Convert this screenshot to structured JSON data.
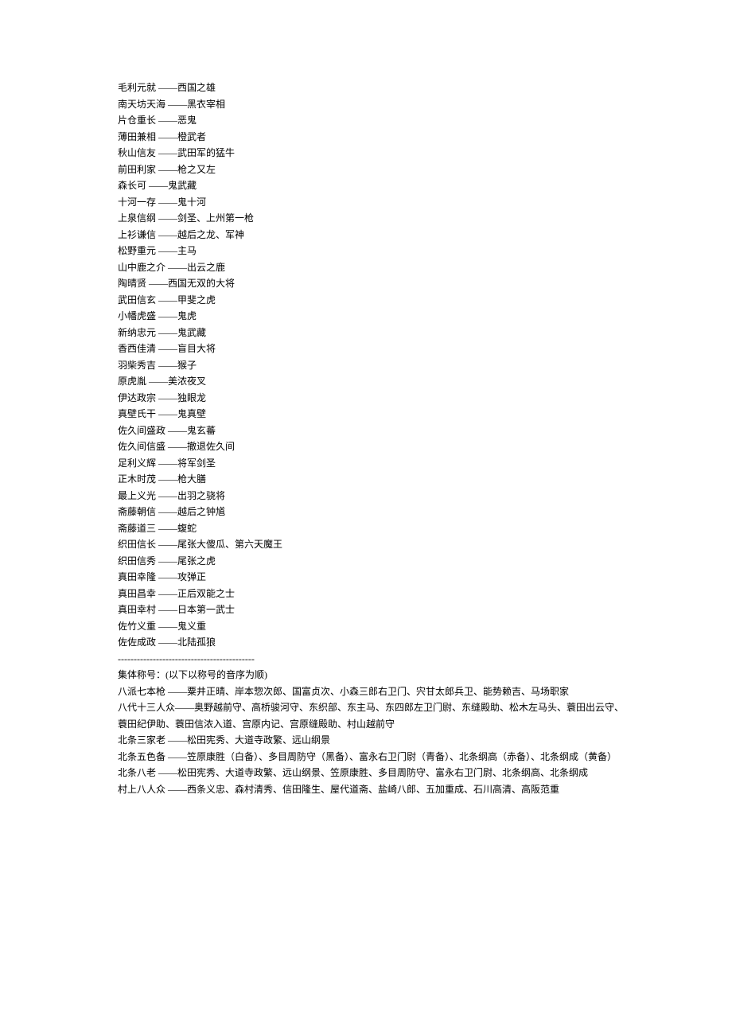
{
  "aliases": [
    {
      "name": "毛利元就",
      "title": "西国之雄"
    },
    {
      "name": "南天坊天海",
      "title": "黑衣宰相"
    },
    {
      "name": "片仓重长",
      "title": "恶鬼"
    },
    {
      "name": "薄田兼相",
      "title": "橙武者"
    },
    {
      "name": "秋山信友",
      "title": "武田军的猛牛"
    },
    {
      "name": "前田利家",
      "title": "枪之又左"
    },
    {
      "name": "森长可",
      "title": "鬼武藏"
    },
    {
      "name": "十河一存",
      "title": "鬼十河"
    },
    {
      "name": "上泉信纲",
      "title": "剑圣、上州第一枪"
    },
    {
      "name": "上衫谦信",
      "title": "越后之龙、军神"
    },
    {
      "name": "松野重元",
      "title": "主马"
    },
    {
      "name": "山中鹿之介",
      "title": "出云之鹿"
    },
    {
      "name": "陶晴贤",
      "title": "西国无双的大将"
    },
    {
      "name": "武田信玄",
      "title": "甲斐之虎"
    },
    {
      "name": "小幡虎盛",
      "title": "鬼虎"
    },
    {
      "name": "新纳忠元",
      "title": "鬼武藏"
    },
    {
      "name": "香西佳清",
      "title": "盲目大将"
    },
    {
      "name": "羽柴秀吉",
      "title": "猴子"
    },
    {
      "name": "原虎胤",
      "title": "美浓夜叉"
    },
    {
      "name": "伊达政宗",
      "title": "独眼龙"
    },
    {
      "name": "真壁氏干",
      "title": "鬼真壁"
    },
    {
      "name": "佐久间盛政",
      "title": "鬼玄蕃"
    },
    {
      "name": "佐久间信盛",
      "title": "撤退佐久间"
    },
    {
      "name": "足利义辉",
      "title": "将军剑圣"
    },
    {
      "name": "正木时茂",
      "title": "枪大膳"
    },
    {
      "name": "最上义光",
      "title": "出羽之骁将"
    },
    {
      "name": "斋藤朝信",
      "title": "越后之钟馗"
    },
    {
      "name": "斋藤道三",
      "title": "蝮蛇"
    },
    {
      "name": "织田信长",
      "title": "尾张大傻瓜、第六天魔王"
    },
    {
      "name": "织田信秀",
      "title": "尾张之虎"
    },
    {
      "name": "真田幸隆",
      "title": "攻弹正"
    },
    {
      "name": "真田昌幸",
      "title": "正后双能之士"
    },
    {
      "name": "真田幸村",
      "title": "日本第一武士"
    },
    {
      "name": "佐竹义重",
      "title": "鬼义重"
    },
    {
      "name": "佐佐成政",
      "title": "北陆孤狼"
    }
  ],
  "divider": "-------------------------------------------",
  "section_header": "集体称号：(以下以称号的音序为顺)",
  "groups": [
    {
      "lines": [
        "八派七本枪 ——粟井正晴、岸本惣次郎、国富贞次、小森三郎右卫门、宍甘太郎兵卫、能势赖吉、马场职家"
      ]
    },
    {
      "lines": [
        "八代十三人众——奥野越前守、高桥骏河守、东织部、东主马、东四郎左卫门尉、东缝殿助、松木左马头、蓑田出云守、",
        "蓑田纪伊助、蓑田信浓入道、宫原内记、宫原缝殿助、村山越前守"
      ]
    },
    {
      "lines": [
        "北条三家老 ——松田宪秀、大道寺政繁、远山纲景"
      ]
    },
    {
      "lines": [
        "北条五色备 ——笠原康胜（白备）、多目周防守（黑备）、富永右卫门尉（青备）、北条纲高（赤备）、北条纲成（黄备）"
      ]
    },
    {
      "lines": [
        "北条八老 ——松田宪秀、大道寺政繁、远山纲景、笠原康胜、多目周防守、富永右卫门尉、北条纲高、北条纲成"
      ]
    },
    {
      "lines": [
        "村上八人众 ——西条义忠、森村清秀、信田隆生、屋代道斋、盐崎八郎、五加重成、石川高清、高阪范重"
      ]
    }
  ]
}
